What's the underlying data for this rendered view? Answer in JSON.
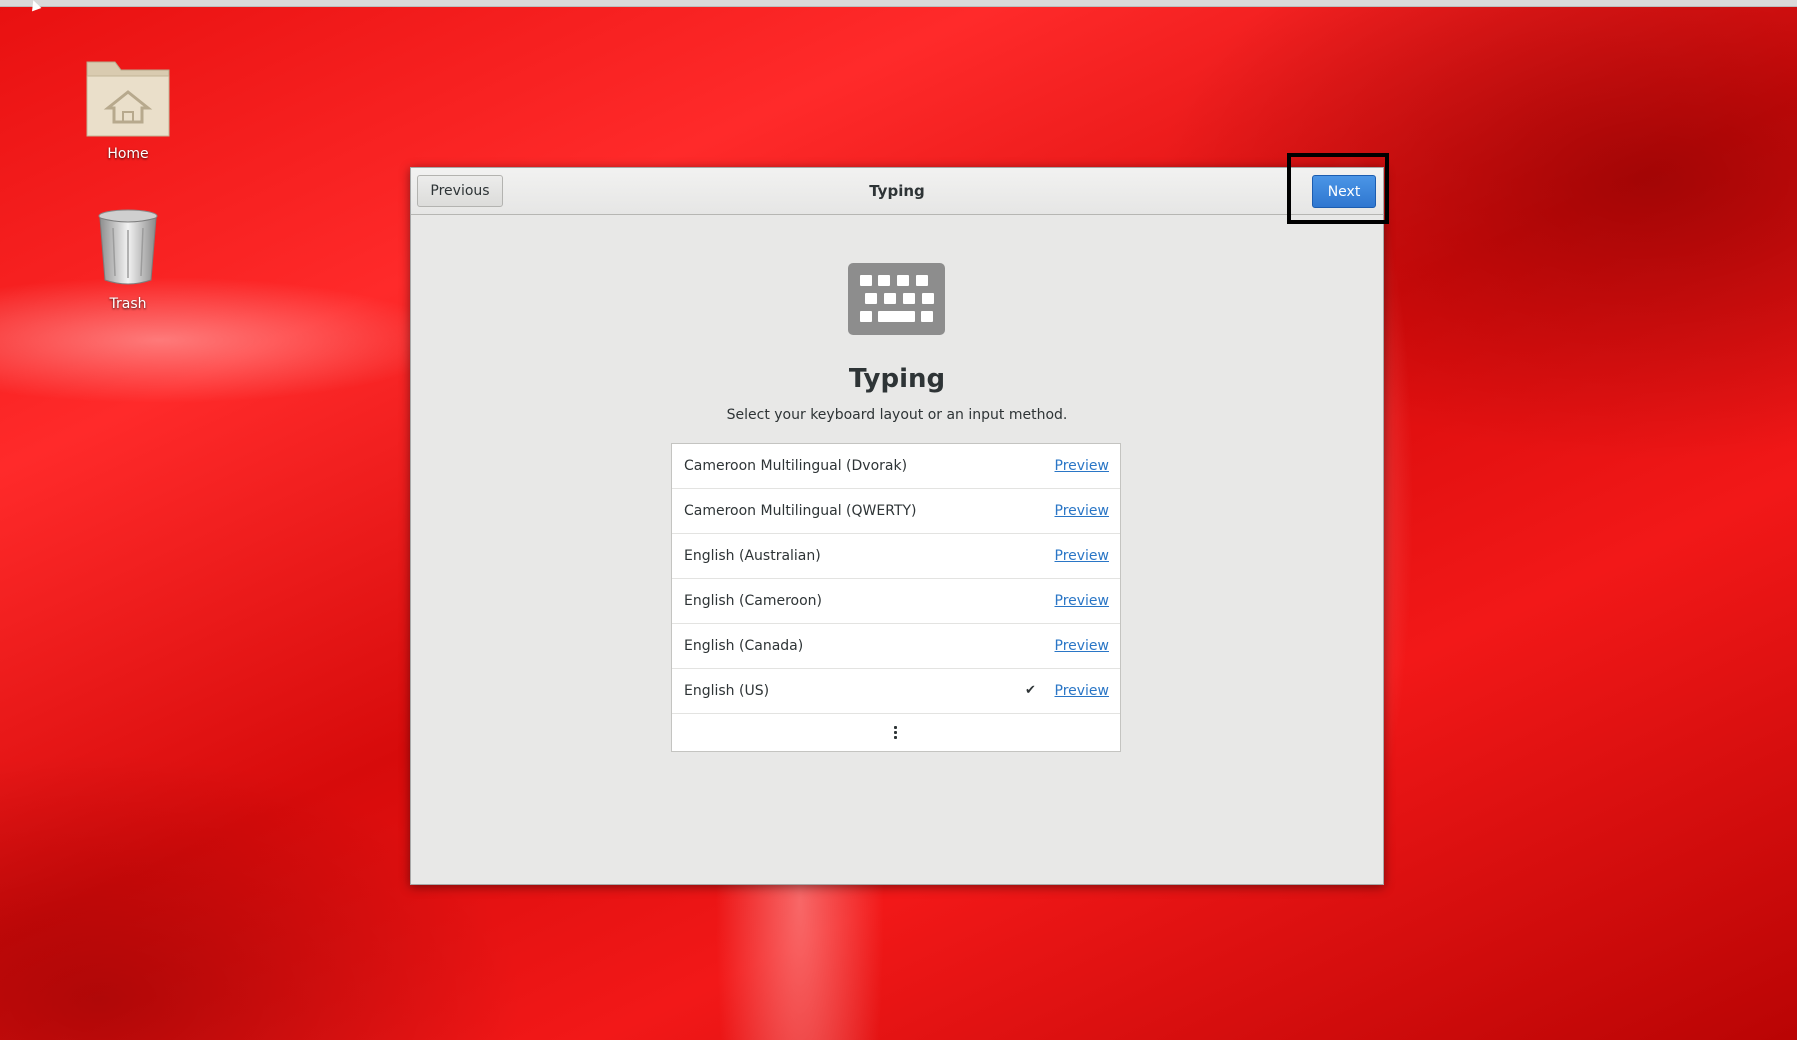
{
  "desktop": {
    "icons": [
      {
        "label": "Home",
        "icon": "home-folder-icon"
      },
      {
        "label": "Trash",
        "icon": "trash-icon"
      }
    ]
  },
  "dialog": {
    "header_title": "Typing",
    "previous_label": "Previous",
    "next_label": "Next",
    "heading": "Typing",
    "subtitle": "Select your keyboard layout or an input method.",
    "layouts": [
      {
        "name": "Cameroon Multilingual (Dvorak)",
        "selected": false,
        "preview_label": "Preview"
      },
      {
        "name": "Cameroon Multilingual (QWERTY)",
        "selected": false,
        "preview_label": "Preview"
      },
      {
        "name": "English (Australian)",
        "selected": false,
        "preview_label": "Preview"
      },
      {
        "name": "English (Cameroon)",
        "selected": false,
        "preview_label": "Preview"
      },
      {
        "name": "English (Canada)",
        "selected": false,
        "preview_label": "Preview"
      },
      {
        "name": "English (US)",
        "selected": true,
        "preview_label": "Preview"
      }
    ],
    "more_icon": "more-vertical-icon",
    "check_icon": "checkmark-icon",
    "keyboard_icon": "keyboard-icon"
  },
  "colors": {
    "accent": "#2f77d0",
    "link": "#2a76c6",
    "wallpaper": "#e81010"
  }
}
